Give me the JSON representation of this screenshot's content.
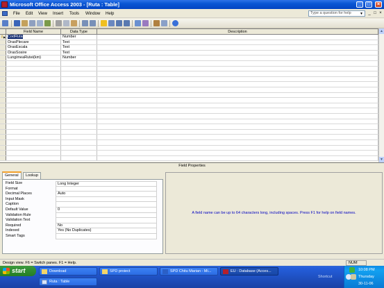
{
  "window": {
    "title": "Microsoft Office Access 2003 - [Ruta : Table]",
    "buttons": {
      "minimize": "_",
      "maximize": "□",
      "close": "×"
    }
  },
  "menu": {
    "items": [
      "File",
      "Edit",
      "View",
      "Insert",
      "Tools",
      "Window",
      "Help"
    ],
    "ask_placeholder": "Type a question for help",
    "child_buttons": [
      "_",
      "□",
      "×"
    ]
  },
  "grid": {
    "headers": {
      "field_name": "Field Name",
      "data_type": "Data Type",
      "description": "Description"
    },
    "rows": [
      {
        "name": "CodRuta",
        "type": "Number",
        "key": true
      },
      {
        "name": "OrasPlecare",
        "type": "Text"
      },
      {
        "name": "OrasEscala",
        "type": "Text"
      },
      {
        "name": "OrasSosire",
        "type": "Text"
      },
      {
        "name": "LungimeaRutei(km)",
        "type": "Number"
      }
    ],
    "empty_rows": 19
  },
  "field_properties": {
    "title": "Field Properties",
    "tabs": [
      "General",
      "Lookup"
    ],
    "props": [
      {
        "label": "Field Size",
        "value": "Long Integer"
      },
      {
        "label": "Format",
        "value": ""
      },
      {
        "label": "Decimal Places",
        "value": "Auto"
      },
      {
        "label": "Input Mask",
        "value": ""
      },
      {
        "label": "Caption",
        "value": ""
      },
      {
        "label": "Default Value",
        "value": "0"
      },
      {
        "label": "Validation Rule",
        "value": ""
      },
      {
        "label": "Validation Text",
        "value": ""
      },
      {
        "label": "Required",
        "value": "No"
      },
      {
        "label": "Indexed",
        "value": "Yes (No Duplicates)"
      },
      {
        "label": "Smart Tags",
        "value": ""
      }
    ],
    "help": "A field name can be up to 64 characters long, including spaces.  Press F1 for help on field names."
  },
  "status": {
    "text": "Design view.  F6 = Switch panes.  F1 = Help.",
    "num": "NUM"
  },
  "taskbar": {
    "start": "start",
    "tasks": [
      {
        "label": "Download",
        "icon": "folder-icon"
      },
      {
        "label": "SPD proiect",
        "icon": "folder-icon"
      },
      {
        "label": "SPD Chitu Marian - Mi...",
        "icon": "word-icon"
      },
      {
        "label": "EU : Database (Acces...",
        "icon": "access-icon",
        "active": true
      },
      {
        "label": "Ruta : Table",
        "icon": "table-icon"
      }
    ],
    "shortcut": "Shortcut",
    "time": "10:08 PM",
    "day": "Thursday",
    "date": "30-11-06"
  },
  "colors": {
    "title_bar": "#0a56d4",
    "taskbar": "#245edb",
    "start": "#2f8b2f",
    "help_text": "#0000c0",
    "selection": "#0a246a"
  }
}
